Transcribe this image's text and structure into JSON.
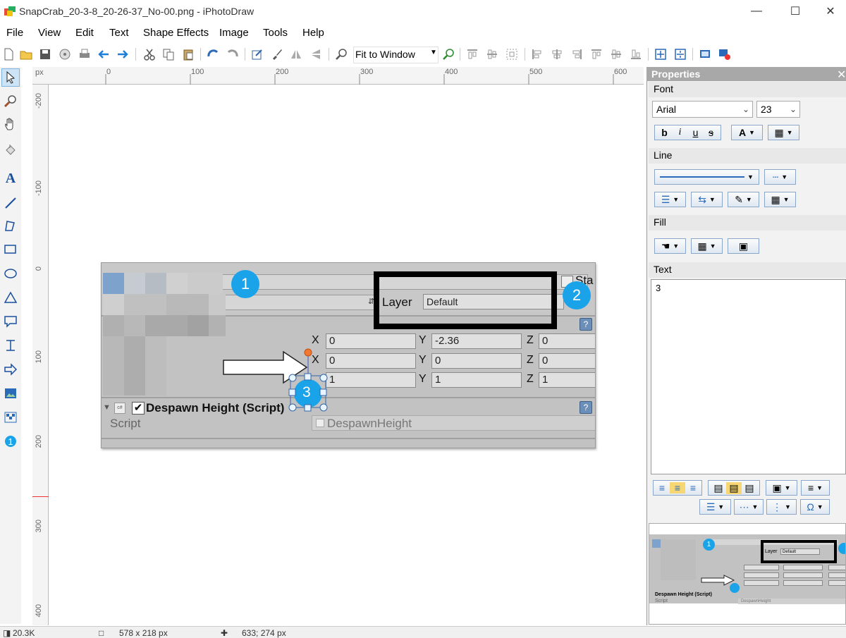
{
  "window": {
    "title": "SnapCrab_20-3-8_20-26-37_No-00.png - iPhotoDraw"
  },
  "menu": [
    "File",
    "View",
    "Edit",
    "Text",
    "Shape Effects",
    "Image",
    "Tools",
    "Help"
  ],
  "toolbar": {
    "zoom_value": "Fit to Window"
  },
  "ruler": {
    "unit": "px",
    "top_ticks": [
      "0",
      "100",
      "200",
      "300",
      "400",
      "500",
      "600"
    ],
    "left_ticks": [
      "-200",
      "-100",
      "0",
      "100",
      "200",
      "300",
      "400"
    ]
  },
  "canvas": {
    "layer_label": "Layer",
    "layer_value": "Default",
    "static_label": "Sta",
    "rows": [
      {
        "x": "0",
        "y": "-2.36",
        "z": "0"
      },
      {
        "x": "0",
        "y": "0",
        "z": "0"
      },
      {
        "x": "1",
        "y": "1",
        "z": "1"
      }
    ],
    "axis_x": "X",
    "axis_y": "Y",
    "axis_z": "Z",
    "component_title": "Despawn Height (Script)",
    "script_label": "Script",
    "script_value": "DespawnHeight",
    "callouts": [
      "1",
      "2",
      "3"
    ]
  },
  "properties": {
    "header": "Properties",
    "font_section": "Font",
    "font_name": "Arial",
    "font_size": "23",
    "line_section": "Line",
    "fill_section": "Fill",
    "text_section": "Text",
    "text_value": "3"
  },
  "status": {
    "file_size": "20.3K",
    "dimensions": "578 x 218 px",
    "cursor": "633; 274 px"
  }
}
